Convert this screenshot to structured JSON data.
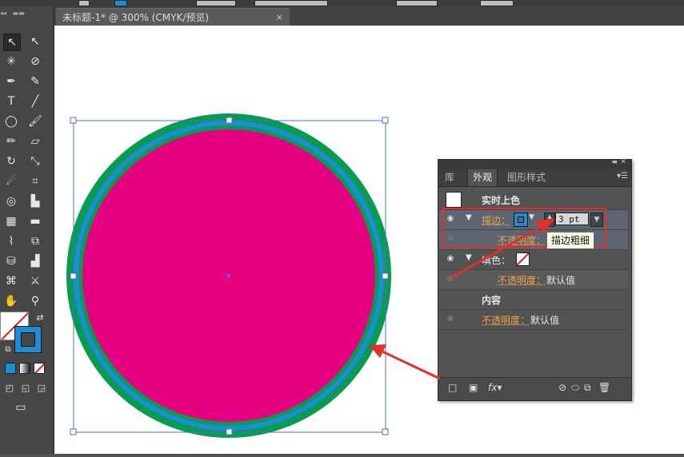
{
  "document": {
    "tab_title": "未标题-1* @ 300% (CMYK/预览)",
    "close_label": "×"
  },
  "colors": {
    "outer_ring": "#0a9b52",
    "stroke_ring": "#1a8fd6",
    "fill": "#e4007f",
    "selection": "#4a6fd1",
    "annotation": "#e0302a"
  },
  "tools": [
    {
      "name": "selection-tool-icon",
      "glyph": "↖"
    },
    {
      "name": "direct-selection-tool-icon",
      "glyph": "↖"
    },
    {
      "name": "magic-wand-tool-icon",
      "glyph": "✳"
    },
    {
      "name": "lasso-tool-icon",
      "glyph": "⊘"
    },
    {
      "name": "pen-tool-icon",
      "glyph": "✒"
    },
    {
      "name": "curvature-tool-icon",
      "glyph": "✎"
    },
    {
      "name": "type-tool-icon",
      "glyph": "T"
    },
    {
      "name": "line-tool-icon",
      "glyph": "╱"
    },
    {
      "name": "ellipse-tool-icon",
      "glyph": "◯"
    },
    {
      "name": "paintbrush-tool-icon",
      "glyph": "🖌"
    },
    {
      "name": "pencil-tool-icon",
      "glyph": "✏"
    },
    {
      "name": "eraser-tool-icon",
      "glyph": "▱"
    },
    {
      "name": "rotate-tool-icon",
      "glyph": "↻"
    },
    {
      "name": "scale-tool-icon",
      "glyph": "⤡"
    },
    {
      "name": "warp-tool-icon",
      "glyph": "☄"
    },
    {
      "name": "free-transform-tool-icon",
      "glyph": "⌗"
    },
    {
      "name": "shape-builder-tool-icon",
      "glyph": "◎"
    },
    {
      "name": "graph-tool-icon",
      "glyph": "▙"
    },
    {
      "name": "mesh-tool-icon",
      "glyph": "▦"
    },
    {
      "name": "gradient-tool-icon",
      "glyph": "▬"
    },
    {
      "name": "eyedropper-tool-icon",
      "glyph": "⌇"
    },
    {
      "name": "blend-tool-icon",
      "glyph": "⧉"
    },
    {
      "name": "symbol-sprayer-tool-icon",
      "glyph": "⛁"
    },
    {
      "name": "column-graph-tool-icon",
      "glyph": "▟"
    },
    {
      "name": "artboard-tool-icon",
      "glyph": "⌘"
    },
    {
      "name": "slice-tool-icon",
      "glyph": "⚔"
    },
    {
      "name": "hand-tool-icon",
      "glyph": "✋"
    },
    {
      "name": "zoom-tool-icon",
      "glyph": "⚲"
    }
  ],
  "panel": {
    "tabs": [
      "库",
      "外观",
      "图形样式"
    ],
    "header_row": "实时上色",
    "stroke_label": "描边：",
    "stroke_value": "3 pt",
    "stroke_opacity_label": "不透明度：",
    "fill_label": "填色：",
    "fill_opacity_label": "不透明度：",
    "fill_opacity_value": "默认值",
    "content_label": "内容",
    "obj_opacity_label": "不透明度：",
    "obj_opacity_value": "默认值"
  },
  "tooltip": "描边粗细"
}
